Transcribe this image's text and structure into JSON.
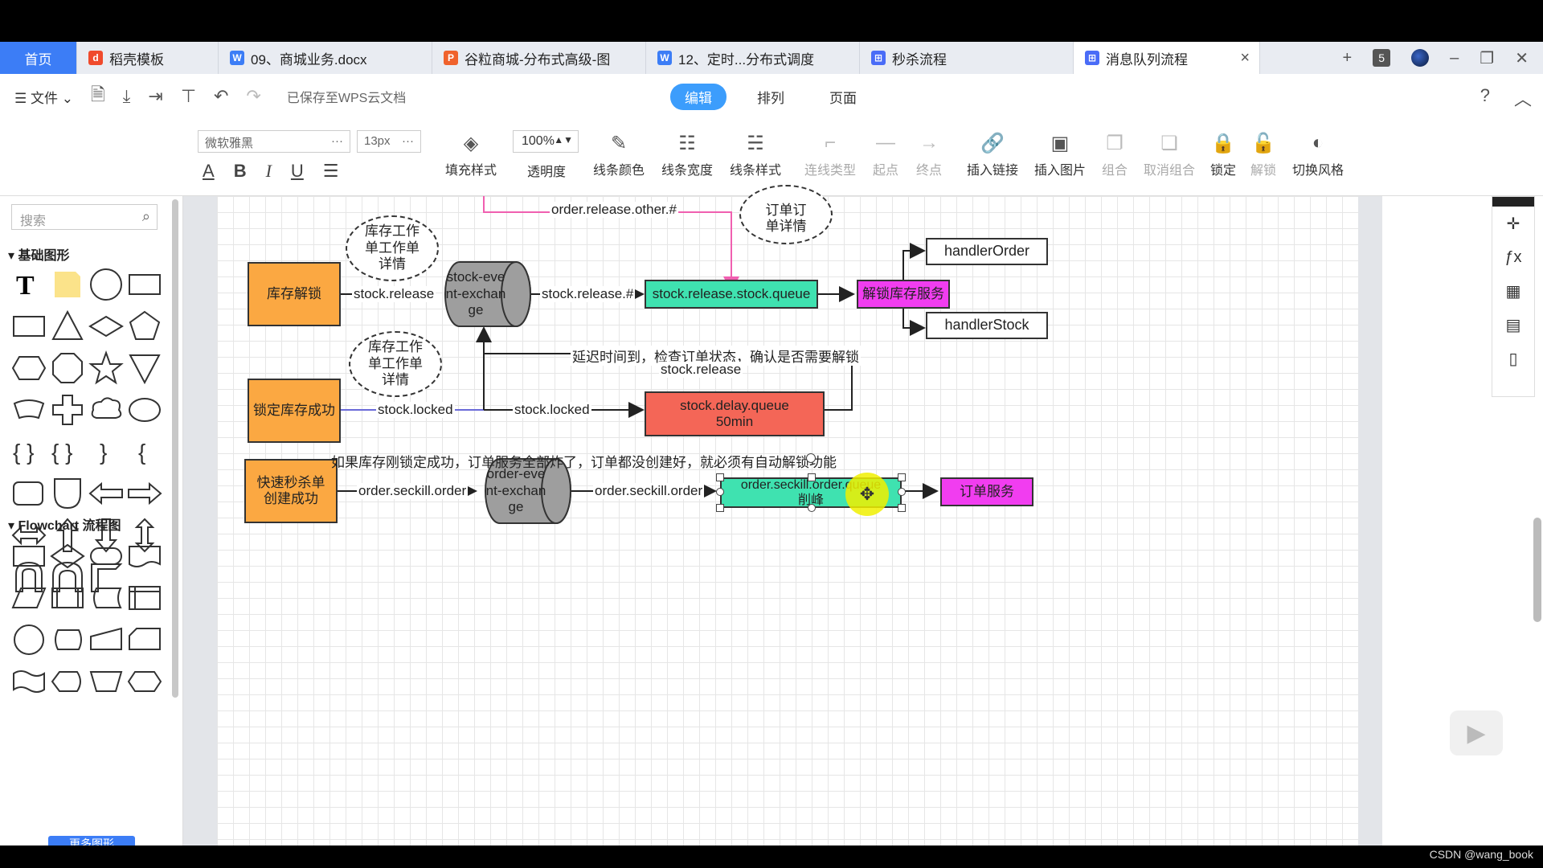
{
  "tabs": [
    {
      "label": "首页",
      "icon": "home"
    },
    {
      "label": "稻壳模板",
      "icon": "docer-icon",
      "color": "#f04a2c"
    },
    {
      "label": "09、商城业务.docx",
      "icon": "word-icon",
      "color": "#3c7df6"
    },
    {
      "label": "谷粒商城-分布式高级-图",
      "icon": "ppt-icon",
      "color": "#f0622c"
    },
    {
      "label": "12、定时...分布式调度",
      "icon": "word-icon",
      "color": "#3c7df6"
    },
    {
      "label": "秒杀流程",
      "icon": "flow-icon",
      "color": "#4a6cf7"
    },
    {
      "label": "消息队列流程",
      "icon": "flow-icon",
      "color": "#4a6cf7"
    }
  ],
  "tabbar": {
    "close": "×",
    "add": "+",
    "count": "5"
  },
  "menu": {
    "file": "文件",
    "saved": "已保存至WPS云文档",
    "modes": [
      "编辑",
      "排列",
      "页面"
    ],
    "help": "?"
  },
  "toolbar": {
    "font": "微软雅黑",
    "size": "13px",
    "opacity": "100%",
    "buttons": [
      {
        "label": "填充样式",
        "icon": "fill-icon",
        "enabled": true
      },
      {
        "label": "透明度",
        "icon": "opacity-icon",
        "enabled": true
      },
      {
        "label": "线条颜色",
        "icon": "line-color-icon",
        "enabled": true
      },
      {
        "label": "线条宽度",
        "icon": "line-width-icon",
        "enabled": true
      },
      {
        "label": "线条样式",
        "icon": "line-style-icon",
        "enabled": true
      },
      {
        "label": "连线类型",
        "icon": "connector-icon",
        "enabled": false
      },
      {
        "label": "起点",
        "icon": "start-icon",
        "enabled": false
      },
      {
        "label": "终点",
        "icon": "end-icon",
        "enabled": false
      },
      {
        "label": "插入链接",
        "icon": "link-icon",
        "enabled": true
      },
      {
        "label": "插入图片",
        "icon": "image-icon",
        "enabled": true
      },
      {
        "label": "组合",
        "icon": "group-icon",
        "enabled": false
      },
      {
        "label": "取消组合",
        "icon": "ungroup-icon",
        "enabled": false
      },
      {
        "label": "锁定",
        "icon": "lock-icon",
        "enabled": true
      },
      {
        "label": "解锁",
        "icon": "unlock-icon",
        "enabled": false
      },
      {
        "label": "切换风格",
        "icon": "style-icon",
        "enabled": true
      }
    ]
  },
  "sidebar": {
    "search_placeholder": "搜索",
    "section1": "基础图形",
    "section2": "Flowchart 流程图",
    "more": "更多图形"
  },
  "diagram": {
    "nodes": {
      "unlock_stock": "库存解锁",
      "lock_success": "锁定库存成功",
      "seckill_created": "快速秒杀单创建成功",
      "stock_exchange": "stock-event-exchange",
      "order_exchange": "order-event-exchange",
      "stock_release_queue": "stock.release.stock.queue",
      "stock_delay_queue": "stock.delay.queue",
      "stock_delay_ttl": "50min",
      "seckill_queue": "order.seckill.order.queue",
      "seckill_queue_sub": "削峰",
      "unlock_service": "解锁库存服务",
      "handler_order": "handlerOrder",
      "handler_stock": "handlerStock",
      "order_service": "订单服务",
      "work_order_1": "库存工作单工作单详情",
      "work_order_2": "库存工作单工作单详情",
      "order_detail": "订单订单详情"
    },
    "edges": {
      "order_release_other": "order.release.other.#",
      "stock_release_1": "stock.release",
      "stock_release_2": "stock.release.#",
      "stock_locked_1": "stock.locked",
      "stock_locked_2": "stock.locked",
      "delay_note": "延迟时间到，检查订单状态，确认是否需要解锁",
      "delay_note_key": "stock.release",
      "seckill_order_1": "order.seckill.order",
      "seckill_order_2": "order.seckill.order"
    },
    "note": "如果库存刚锁定成功，订单服务全部炸了，订单都没创建好，就必须有自动解锁功能"
  },
  "colors": {
    "orange": "#fba842",
    "teal": "#3fe2b0",
    "magenta": "#f13df0",
    "red": "#f46657",
    "gray": "#9e9e9e",
    "accent": "#3c7df6"
  },
  "watermark": "CSDN @wang_book"
}
